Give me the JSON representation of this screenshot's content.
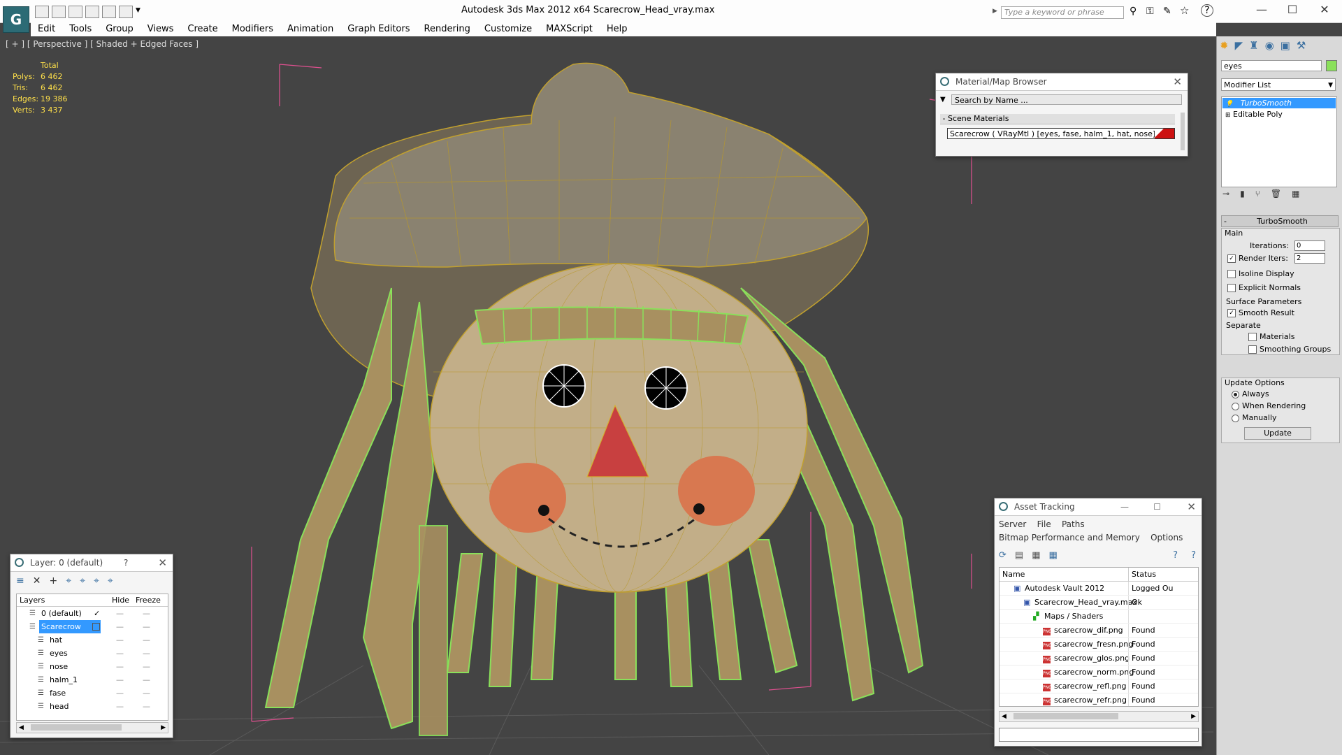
{
  "window": {
    "title": "Autodesk 3ds Max  2012 x64     Scarecrow_Head_vray.max",
    "search_placeholder": "Type a keyword or phrase",
    "minimize": "—",
    "maximize": "☐",
    "close": "✕"
  },
  "menu": [
    "Edit",
    "Tools",
    "Group",
    "Views",
    "Create",
    "Modifiers",
    "Animation",
    "Graph Editors",
    "Rendering",
    "Customize",
    "MAXScript",
    "Help"
  ],
  "viewport": {
    "label": "[ + ] [ Perspective ] [ Shaded + Edged Faces ]",
    "stats_header": "Total",
    "stats": [
      {
        "label": "Polys:",
        "value": "6 462"
      },
      {
        "label": "Tris:",
        "value": "6 462"
      },
      {
        "label": "Edges:",
        "value": "19 386"
      },
      {
        "label": "Verts:",
        "value": "3 437"
      }
    ]
  },
  "material_browser": {
    "title": "Material/Map Browser",
    "search_placeholder": "Search by Name ...",
    "section": "Scene Materials",
    "item": "Scarecrow  ( VRayMtl ) [eyes, fase, halm_1, hat, nose]"
  },
  "command_panel": {
    "object_name": "eyes",
    "modifier_list_label": "Modifier List",
    "stack": [
      "TurboSmooth",
      "Editable Poly"
    ],
    "rollout_title": "TurboSmooth",
    "main_label": "Main",
    "iterations_label": "Iterations:",
    "iterations_value": "0",
    "render_iters_label": "Render Iters:",
    "render_iters_value": "2",
    "isoline_label": "Isoline Display",
    "explicit_normals_label": "Explicit Normals",
    "surface_params_label": "Surface Parameters",
    "smooth_result_label": "Smooth Result",
    "separate_label": "Separate",
    "materials_label": "Materials",
    "smoothing_groups_label": "Smoothing Groups",
    "update_options_label": "Update Options",
    "always_label": "Always",
    "when_rendering_label": "When Rendering",
    "manually_label": "Manually",
    "update_button": "Update"
  },
  "layer_panel": {
    "title": "Layer: 0 (default)",
    "help": "?",
    "columns": {
      "layers": "Layers",
      "hide": "Hide",
      "freeze": "Freeze"
    },
    "rows": [
      {
        "name": "0 (default)",
        "level": 0,
        "selected": false
      },
      {
        "name": "Scarecrow",
        "level": 0,
        "selected": true
      },
      {
        "name": "hat",
        "level": 1,
        "selected": false
      },
      {
        "name": "eyes",
        "level": 1,
        "selected": false
      },
      {
        "name": "nose",
        "level": 1,
        "selected": false
      },
      {
        "name": "halm_1",
        "level": 1,
        "selected": false
      },
      {
        "name": "fase",
        "level": 1,
        "selected": false
      },
      {
        "name": "head",
        "level": 1,
        "selected": false
      }
    ]
  },
  "asset_tracking": {
    "title": "Asset Tracking",
    "menu1": [
      "Server",
      "File",
      "Paths"
    ],
    "menu2": [
      "Bitmap Performance and Memory",
      "Options"
    ],
    "columns": {
      "name": "Name",
      "status": "Status"
    },
    "rows": [
      {
        "name": "Autodesk Vault 2012",
        "status": "Logged Ou",
        "indent": 0
      },
      {
        "name": "Scarecrow_Head_vray.max",
        "status": "Ok",
        "indent": 1
      },
      {
        "name": "Maps / Shaders",
        "status": "",
        "indent": 2
      },
      {
        "name": "scarecrow_dif.png",
        "status": "Found",
        "indent": 3
      },
      {
        "name": "scarecrow_fresn.png",
        "status": "Found",
        "indent": 3
      },
      {
        "name": "scarecrow_glos.png",
        "status": "Found",
        "indent": 3
      },
      {
        "name": "scarecrow_norm.png",
        "status": "Found",
        "indent": 3
      },
      {
        "name": "scarecrow_refl.png",
        "status": "Found",
        "indent": 3
      },
      {
        "name": "scarecrow_refr.png",
        "status": "Found",
        "indent": 3
      }
    ]
  },
  "colors": {
    "accent": "#3399ff",
    "selection_wire": "#8ae05a",
    "stats_text": "#ffe04a",
    "material_swatch": "#cc1111"
  }
}
